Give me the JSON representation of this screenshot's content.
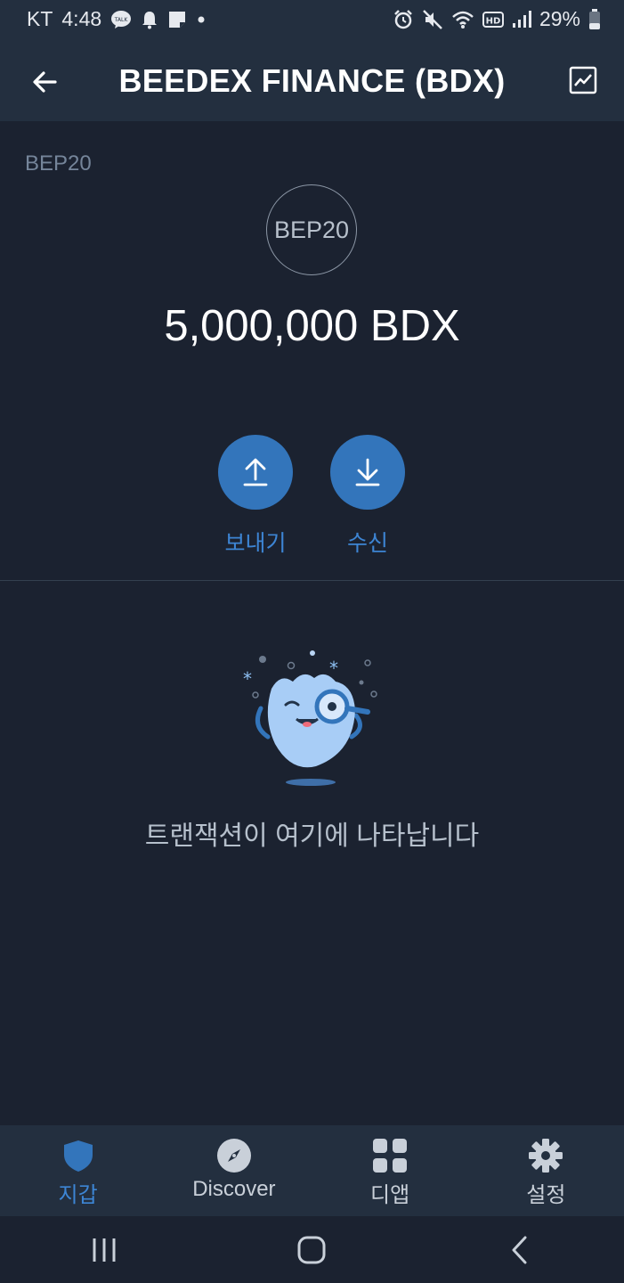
{
  "status_bar": {
    "carrier": "KT",
    "time": "4:48",
    "battery": "29%",
    "icons_left": [
      "kakaotalk-icon",
      "bell-icon",
      "note-icon",
      "dot-icon"
    ],
    "icons_right": [
      "alarm-icon",
      "mute-icon",
      "wifi-icon",
      "hd-icon",
      "signal-icon",
      "battery-icon"
    ]
  },
  "header": {
    "title": "BEEDEX FINANCE (BDX)",
    "back_icon": "arrow-left-icon",
    "chart_icon": "chart-icon"
  },
  "token": {
    "network": "BEP20",
    "logo_text": "BEP20",
    "balance": "5,000,000 BDX"
  },
  "actions": [
    {
      "label": "보내기",
      "icon": "arrow-up-icon"
    },
    {
      "label": "수신",
      "icon": "arrow-down-icon"
    }
  ],
  "empty_state": {
    "message": "트랜잭션이 여기에 나타납니다",
    "illustration": "search-mascot-illustration"
  },
  "bottom_nav": [
    {
      "label": "지갑",
      "icon": "shield-icon",
      "active": true
    },
    {
      "label": "Discover",
      "icon": "compass-icon",
      "active": false
    },
    {
      "label": "디앱",
      "icon": "grid-icon",
      "active": false
    },
    {
      "label": "설정",
      "icon": "gear-icon",
      "active": false
    }
  ],
  "system_nav": [
    "recent-apps-icon",
    "home-icon",
    "back-icon"
  ],
  "colors": {
    "background": "#1b2230",
    "bar": "#232f3f",
    "accent": "#3375bb",
    "accent_text": "#3d85d4"
  }
}
